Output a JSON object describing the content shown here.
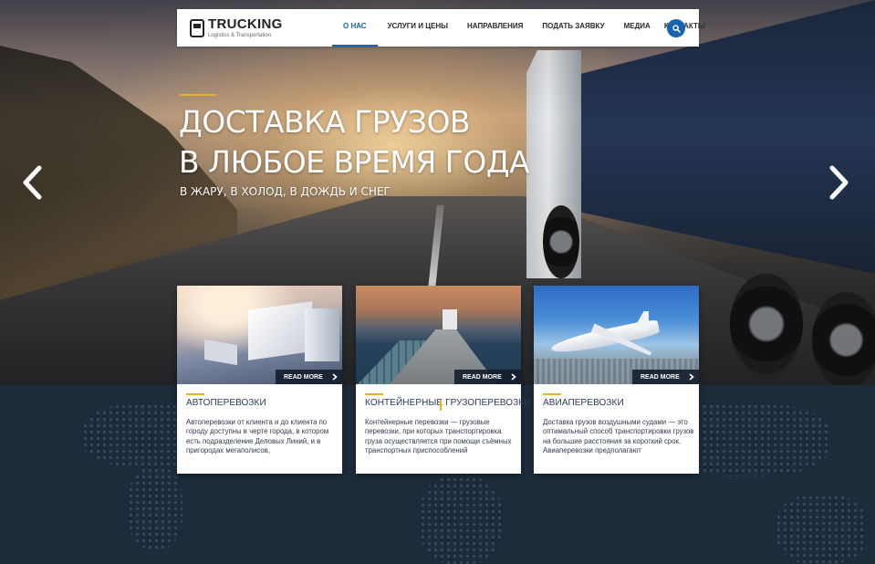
{
  "brand": {
    "title": "TRUCKING",
    "subtitle": "Logistics & Transportation",
    "accent_color": "#e7b325",
    "primary_color": "#1565b0"
  },
  "nav": {
    "items": [
      {
        "label": "О НАС",
        "active": true
      },
      {
        "label": "УСЛУГИ И ЦЕНЫ",
        "active": false
      },
      {
        "label": "НАПРАВЛЕНИЯ",
        "active": false
      },
      {
        "label": "ПОДАТЬ ЗАЯВКУ",
        "active": false
      },
      {
        "label": "МЕДИА",
        "active": false
      },
      {
        "label": "КОНТАКТЫ",
        "active": false
      }
    ],
    "search_icon": "search-icon"
  },
  "hero": {
    "title_line1": "ДОСТАВКА ГРУЗОВ",
    "title_line2": "В ЛЮБОЕ ВРЕМЯ ГОДА",
    "subtitle": "В ЖАРУ, В ХОЛОД, В ДОЖДЬ И СНЕГ",
    "prev_icon": "chevron-left-icon",
    "next_icon": "chevron-right-icon"
  },
  "cards": [
    {
      "title": "АВТОПЕРЕВОЗКИ",
      "text": "Автоперевозки от клиента и до клиента по городу доступны в черте города, в котором есть подразделение Деловых Линий, и в пригородах мегаполисов,",
      "button": "READ MORE"
    },
    {
      "title": "КОНТЕЙНЕРНЫЕ ГРУЗОПЕРЕВОЗКИ",
      "text": "Контейнерные перевозки — грузовые перевозки, при которых транспортировка груза осуществляется при помощи съёмных транспортных приспособлений",
      "button": "READ MORE"
    },
    {
      "title": "АВИАПЕРЕВОЗКИ",
      "text": "Доставка грузов воздушными судами — это оптимальный способ транспортировки грузов на большие расстояния за короткий срок. Авиаперевозки предполагают",
      "button": "READ MORE"
    }
  ]
}
